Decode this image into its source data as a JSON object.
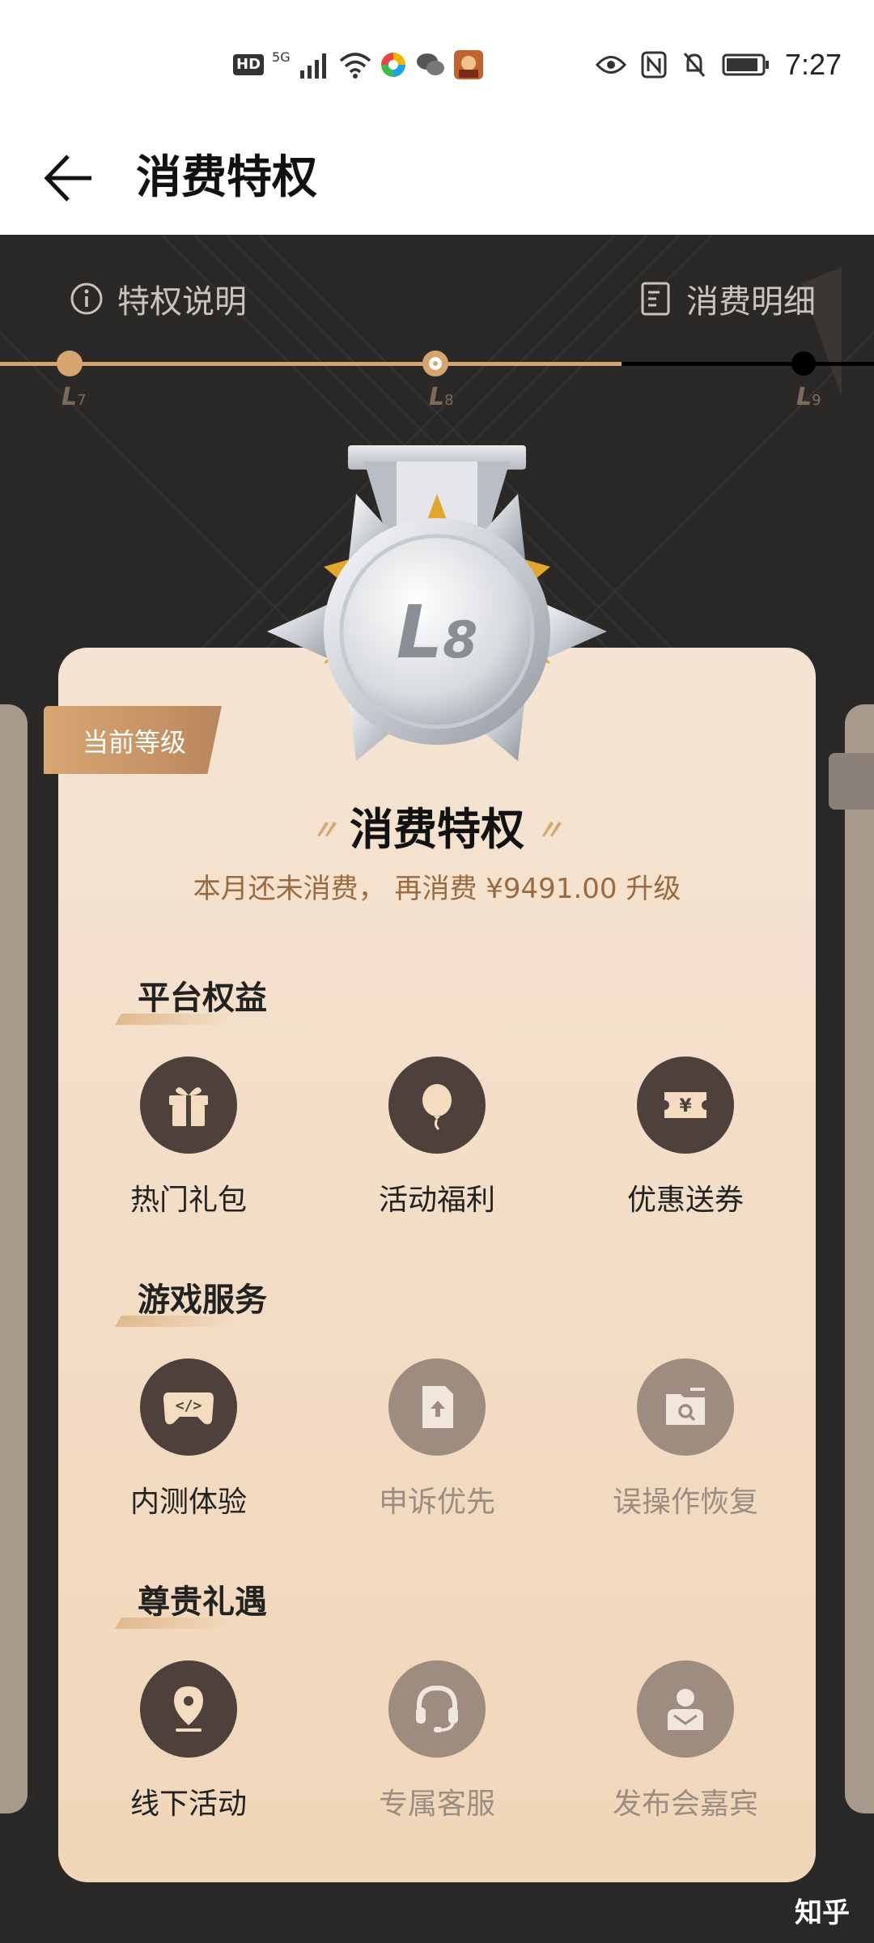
{
  "status_bar": {
    "left_icons": [
      "hd-icon",
      "5g-signal-icon",
      "wifi-icon",
      "app-icon",
      "wechat-icon",
      "game-icon"
    ],
    "hd": "HD",
    "network": "5G",
    "right_icons": [
      "eye-icon",
      "nfc-icon",
      "mute-icon",
      "battery-icon"
    ],
    "time": "7:27"
  },
  "header": {
    "title": "消费特权"
  },
  "top_links": {
    "left": "特权说明",
    "right": "消费明细"
  },
  "levels": [
    {
      "letter": "L",
      "num": "7",
      "state": "completed"
    },
    {
      "letter": "L",
      "num": "8",
      "state": "current"
    },
    {
      "letter": "L",
      "num": "9",
      "state": "locked"
    }
  ],
  "medal": {
    "letter": "L",
    "num": "8"
  },
  "card": {
    "badge": "当前等级",
    "title": "消费特权",
    "subtitle": "本月还未消费， 再消费 ¥9491.00 升级"
  },
  "sections": [
    {
      "title": "平台权益",
      "items": [
        {
          "label": "热门礼包",
          "icon": "gift-icon",
          "active": true
        },
        {
          "label": "活动福利",
          "icon": "balloon-icon",
          "active": true
        },
        {
          "label": "优惠送券",
          "icon": "coupon-icon",
          "active": true
        }
      ]
    },
    {
      "title": "游戏服务",
      "items": [
        {
          "label": "内测体验",
          "icon": "gamepad-code-icon",
          "active": true
        },
        {
          "label": "申诉优先",
          "icon": "upload-file-icon",
          "active": false
        },
        {
          "label": "误操作恢复",
          "icon": "folder-search-icon",
          "active": false
        }
      ]
    },
    {
      "title": "尊贵礼遇",
      "items": [
        {
          "label": "线下活动",
          "icon": "location-pin-icon",
          "active": true
        },
        {
          "label": "专属客服",
          "icon": "headset-icon",
          "active": false
        },
        {
          "label": "发布会嘉宾",
          "icon": "guest-card-icon",
          "active": false
        }
      ]
    }
  ],
  "colors": {
    "accent": "#d6a46f",
    "dark_bg": "#2b2928",
    "icon_active": "#4e403b",
    "icon_inactive": "#9e8c80"
  },
  "watermark": "知乎"
}
